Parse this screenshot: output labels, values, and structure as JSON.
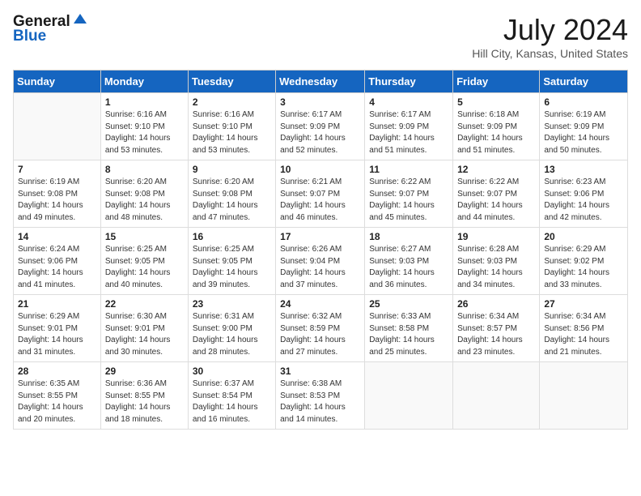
{
  "logo": {
    "general": "General",
    "blue": "Blue"
  },
  "title": "July 2024",
  "location": "Hill City, Kansas, United States",
  "weekdays": [
    "Sunday",
    "Monday",
    "Tuesday",
    "Wednesday",
    "Thursday",
    "Friday",
    "Saturday"
  ],
  "weeks": [
    [
      {
        "day": null
      },
      {
        "day": 1,
        "sunrise": "6:16 AM",
        "sunset": "9:10 PM",
        "daylight": "14 hours and 53 minutes."
      },
      {
        "day": 2,
        "sunrise": "6:16 AM",
        "sunset": "9:10 PM",
        "daylight": "14 hours and 53 minutes."
      },
      {
        "day": 3,
        "sunrise": "6:17 AM",
        "sunset": "9:09 PM",
        "daylight": "14 hours and 52 minutes."
      },
      {
        "day": 4,
        "sunrise": "6:17 AM",
        "sunset": "9:09 PM",
        "daylight": "14 hours and 51 minutes."
      },
      {
        "day": 5,
        "sunrise": "6:18 AM",
        "sunset": "9:09 PM",
        "daylight": "14 hours and 51 minutes."
      },
      {
        "day": 6,
        "sunrise": "6:19 AM",
        "sunset": "9:09 PM",
        "daylight": "14 hours and 50 minutes."
      }
    ],
    [
      {
        "day": 7,
        "sunrise": "6:19 AM",
        "sunset": "9:08 PM",
        "daylight": "14 hours and 49 minutes."
      },
      {
        "day": 8,
        "sunrise": "6:20 AM",
        "sunset": "9:08 PM",
        "daylight": "14 hours and 48 minutes."
      },
      {
        "day": 9,
        "sunrise": "6:20 AM",
        "sunset": "9:08 PM",
        "daylight": "14 hours and 47 minutes."
      },
      {
        "day": 10,
        "sunrise": "6:21 AM",
        "sunset": "9:07 PM",
        "daylight": "14 hours and 46 minutes."
      },
      {
        "day": 11,
        "sunrise": "6:22 AM",
        "sunset": "9:07 PM",
        "daylight": "14 hours and 45 minutes."
      },
      {
        "day": 12,
        "sunrise": "6:22 AM",
        "sunset": "9:07 PM",
        "daylight": "14 hours and 44 minutes."
      },
      {
        "day": 13,
        "sunrise": "6:23 AM",
        "sunset": "9:06 PM",
        "daylight": "14 hours and 42 minutes."
      }
    ],
    [
      {
        "day": 14,
        "sunrise": "6:24 AM",
        "sunset": "9:06 PM",
        "daylight": "14 hours and 41 minutes."
      },
      {
        "day": 15,
        "sunrise": "6:25 AM",
        "sunset": "9:05 PM",
        "daylight": "14 hours and 40 minutes."
      },
      {
        "day": 16,
        "sunrise": "6:25 AM",
        "sunset": "9:05 PM",
        "daylight": "14 hours and 39 minutes."
      },
      {
        "day": 17,
        "sunrise": "6:26 AM",
        "sunset": "9:04 PM",
        "daylight": "14 hours and 37 minutes."
      },
      {
        "day": 18,
        "sunrise": "6:27 AM",
        "sunset": "9:03 PM",
        "daylight": "14 hours and 36 minutes."
      },
      {
        "day": 19,
        "sunrise": "6:28 AM",
        "sunset": "9:03 PM",
        "daylight": "14 hours and 34 minutes."
      },
      {
        "day": 20,
        "sunrise": "6:29 AM",
        "sunset": "9:02 PM",
        "daylight": "14 hours and 33 minutes."
      }
    ],
    [
      {
        "day": 21,
        "sunrise": "6:29 AM",
        "sunset": "9:01 PM",
        "daylight": "14 hours and 31 minutes."
      },
      {
        "day": 22,
        "sunrise": "6:30 AM",
        "sunset": "9:01 PM",
        "daylight": "14 hours and 30 minutes."
      },
      {
        "day": 23,
        "sunrise": "6:31 AM",
        "sunset": "9:00 PM",
        "daylight": "14 hours and 28 minutes."
      },
      {
        "day": 24,
        "sunrise": "6:32 AM",
        "sunset": "8:59 PM",
        "daylight": "14 hours and 27 minutes."
      },
      {
        "day": 25,
        "sunrise": "6:33 AM",
        "sunset": "8:58 PM",
        "daylight": "14 hours and 25 minutes."
      },
      {
        "day": 26,
        "sunrise": "6:34 AM",
        "sunset": "8:57 PM",
        "daylight": "14 hours and 23 minutes."
      },
      {
        "day": 27,
        "sunrise": "6:34 AM",
        "sunset": "8:56 PM",
        "daylight": "14 hours and 21 minutes."
      }
    ],
    [
      {
        "day": 28,
        "sunrise": "6:35 AM",
        "sunset": "8:55 PM",
        "daylight": "14 hours and 20 minutes."
      },
      {
        "day": 29,
        "sunrise": "6:36 AM",
        "sunset": "8:55 PM",
        "daylight": "14 hours and 18 minutes."
      },
      {
        "day": 30,
        "sunrise": "6:37 AM",
        "sunset": "8:54 PM",
        "daylight": "14 hours and 16 minutes."
      },
      {
        "day": 31,
        "sunrise": "6:38 AM",
        "sunset": "8:53 PM",
        "daylight": "14 hours and 14 minutes."
      },
      {
        "day": null
      },
      {
        "day": null
      },
      {
        "day": null
      }
    ]
  ]
}
